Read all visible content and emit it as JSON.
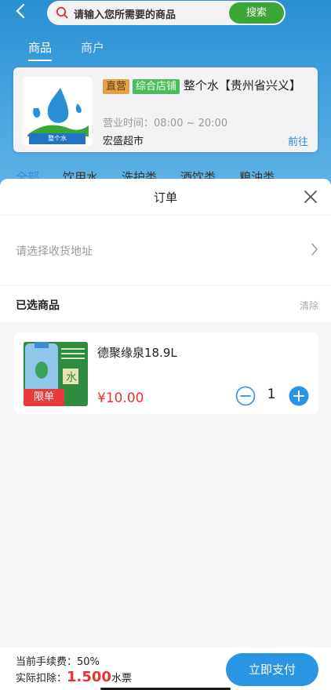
{
  "nav": {
    "back_icon": "chevron-left-icon",
    "search_placeholder": "请输入您所需要的商品",
    "search_button": "搜索",
    "search_button_color": "#3aa635"
  },
  "top_tabs": [
    {
      "label": "商品",
      "active": true
    },
    {
      "label": "商户",
      "active": false
    }
  ],
  "store": {
    "tag_direct": "直营",
    "tag_store": "综合店铺",
    "name": "整个水【贵州省兴义】",
    "hours": "营业时间：08:00 ~ 20:00",
    "title": "宏盛超市",
    "go_label": "前往",
    "logo_caption": "整个水"
  },
  "categories": [
    "全部",
    "饮用水",
    "洗护类",
    "酒饮类",
    "粮油类"
  ],
  "sheet": {
    "title": "订单",
    "close_icon": "close-icon",
    "address_placeholder": "请选择收货地址",
    "selected_title": "已选商品",
    "clear_label": "清除"
  },
  "product": {
    "name": "德聚缘泉18.9L",
    "price": "¥10.00",
    "quantity": "1",
    "badge": "限单",
    "image_char": "水"
  },
  "footer": {
    "fee": "当前手续费：50%",
    "deduct_label": "实际扣除：",
    "deduct_amount": "1.500",
    "deduct_unit": "水票",
    "pay_button": "立即支付",
    "accent_color": "#2a95e3",
    "price_color": "#e8322e"
  }
}
